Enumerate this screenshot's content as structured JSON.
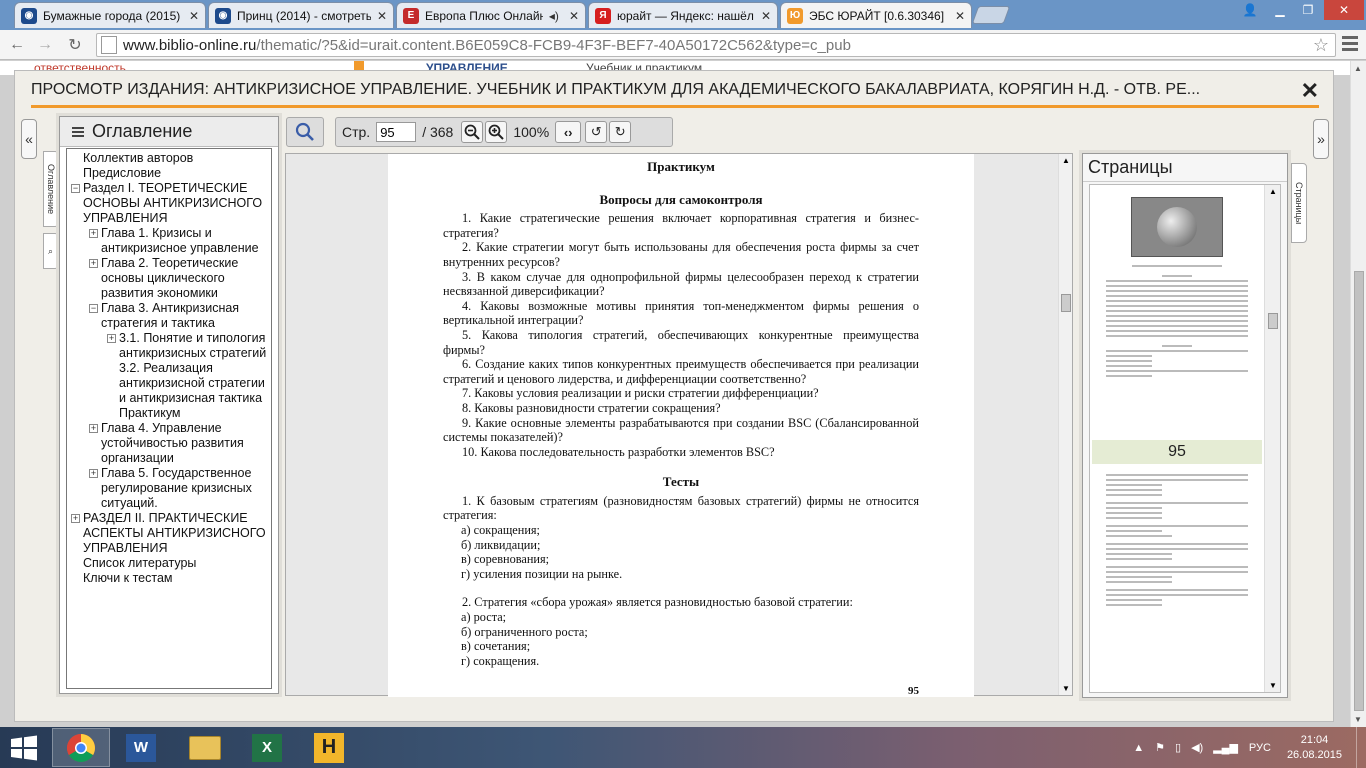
{
  "browser": {
    "tabs": [
      {
        "title": "Бумажные города (2015)",
        "icon_color": "#1d4a8c",
        "icon": "globe-icon"
      },
      {
        "title": "Принц (2014) - смотреть",
        "icon_color": "#1d4a8c",
        "icon": "globe-icon"
      },
      {
        "title": "Европа Плюс Онлайн",
        "icon_color": "#c42b2b",
        "icon": "europa-icon"
      },
      {
        "title": "юрайт — Яндекс: нашёл",
        "icon_color": "#d61f1f",
        "icon": "yandex-icon"
      },
      {
        "title": "ЭБС ЮРАЙТ [0.6.30346]",
        "icon_color": "#f19a2c",
        "icon": "urait-icon"
      }
    ],
    "url_host": "www.biblio-online.ru",
    "url_path": "/thematic/?5&id=urait.content.B6E059C8-FCB9-4F3F-BEF7-40A50172C562&type=c_pub"
  },
  "background_strip": {
    "left_text": "ответственность",
    "mid_text": "управление",
    "right_text": "Учебник и практикум"
  },
  "viewer": {
    "title": "ПРОСМОТР ИЗДАНИЯ: АНТИКРИЗИСНОЕ УПРАВЛЕНИЕ. УЧЕБНИК И ПРАКТИКУМ ДЛЯ АКАДЕМИЧЕСКОГО БАКАЛАВРИАТА, КОРЯГИН Н.Д. - ОТВ. РЕ...",
    "close": "✕",
    "toc_tab": "Оглавление",
    "pages_tab": "Страницы",
    "toolbar": {
      "page_label": "Стр.",
      "page_value": "95",
      "page_total": "/ 368",
      "zoom": "100%"
    }
  },
  "toc": {
    "title": "Оглавление",
    "items": [
      {
        "text": "Коллектив авторов",
        "level": 0,
        "toggle": ""
      },
      {
        "text": "Предисловие",
        "level": 0,
        "toggle": ""
      },
      {
        "text": "Раздел I. ТЕОРЕТИЧЕСКИЕ ОСНОВЫ АНТИКРИЗИСНОГО УПРАВЛЕНИЯ",
        "level": 0,
        "toggle": "−"
      },
      {
        "text": "Глава 1. Кризисы и антикризисное управление",
        "level": 1,
        "toggle": "+"
      },
      {
        "text": "Глава 2. Теоретические основы циклического развития экономики",
        "level": 1,
        "toggle": "+"
      },
      {
        "text": "Глава 3. Антикризисная стратегия и тактика",
        "level": 1,
        "toggle": "−"
      },
      {
        "text": "3.1. Понятие и типология антикризисных стратегий",
        "level": 2,
        "toggle": "+"
      },
      {
        "text": "3.2. Реализация антикризисной стратегии и антикризисная тактика",
        "level": 2,
        "toggle": ""
      },
      {
        "text": "Практикум",
        "level": 2,
        "toggle": ""
      },
      {
        "text": "Глава 4. Управление устойчивостью развития организации",
        "level": 1,
        "toggle": "+"
      },
      {
        "text": "Глава 5. Государственное регулирование кризисных ситуаций.",
        "level": 1,
        "toggle": "+"
      },
      {
        "text": "РАЗДЕЛ II. ПРАКТИЧЕСКИЕ АСПЕКТЫ АНТИКРИЗИСНОГО УПРАВЛЕНИЯ",
        "level": 0,
        "toggle": "+"
      },
      {
        "text": "Список литературы",
        "level": 0,
        "toggle": ""
      },
      {
        "text": "Ключи к тестам",
        "level": 0,
        "toggle": ""
      }
    ]
  },
  "document": {
    "heading": "Практикум",
    "section1": "Вопросы для самоконтроля",
    "questions": [
      "1. Какие стратегические решения включает корпоративная стратегия и бизнес-стратегия?",
      "2. Какие стратегии могут быть использованы для обеспечения роста фирмы за счет внутренних ресурсов?",
      "3. В каком случае для однопрофильной фирмы целесообразен переход к стратегии несвязанной диверсификации?",
      "4. Каковы возможные мотивы принятия топ-менеджментом фирмы решения о вертикальной интеграции?",
      "5. Какова типология стратегий, обеспечивающих конкурентные преимущества фирмы?",
      "6. Создание каких типов конкурентных преимуществ обеспечивается при реализации стратегий и ценового лидерства, и дифференциации соответственно?",
      "7. Каковы условия реализации и риски стратегии дифференциации?",
      "8. Каковы разновидности стратегии сокращения?",
      "9. Какие основные элементы разрабатываются при создании BSC (Сбалансированной системы показателей)?",
      "10. Какова последовательность разработки элементов BSC?"
    ],
    "section2": "Тесты",
    "test1": "1. К базовым стратегиям (разновидностям базовых стратегий) фирмы не относится стратегия:",
    "test1_options": [
      "а) сокращения;",
      "б) ликвидации;",
      "в) соревнования;",
      "г) усиления позиции на рынке."
    ],
    "test2": "2. Стратегия «сбора урожая» является разновидностью базовой стратегии:",
    "test2_options": [
      "а) роста;",
      "б) ограниченного роста;",
      "в) сочетания;",
      "г) сокращения."
    ],
    "page_number": "95"
  },
  "pages_panel": {
    "title": "Страницы",
    "current_page": "95"
  },
  "taskbar": {
    "apps": [
      "chrome-icon",
      "word-icon",
      "explorer-icon",
      "excel-icon",
      "h-app-icon"
    ],
    "lang": "РУС",
    "time": "21:04",
    "date": "26.08.2015"
  }
}
